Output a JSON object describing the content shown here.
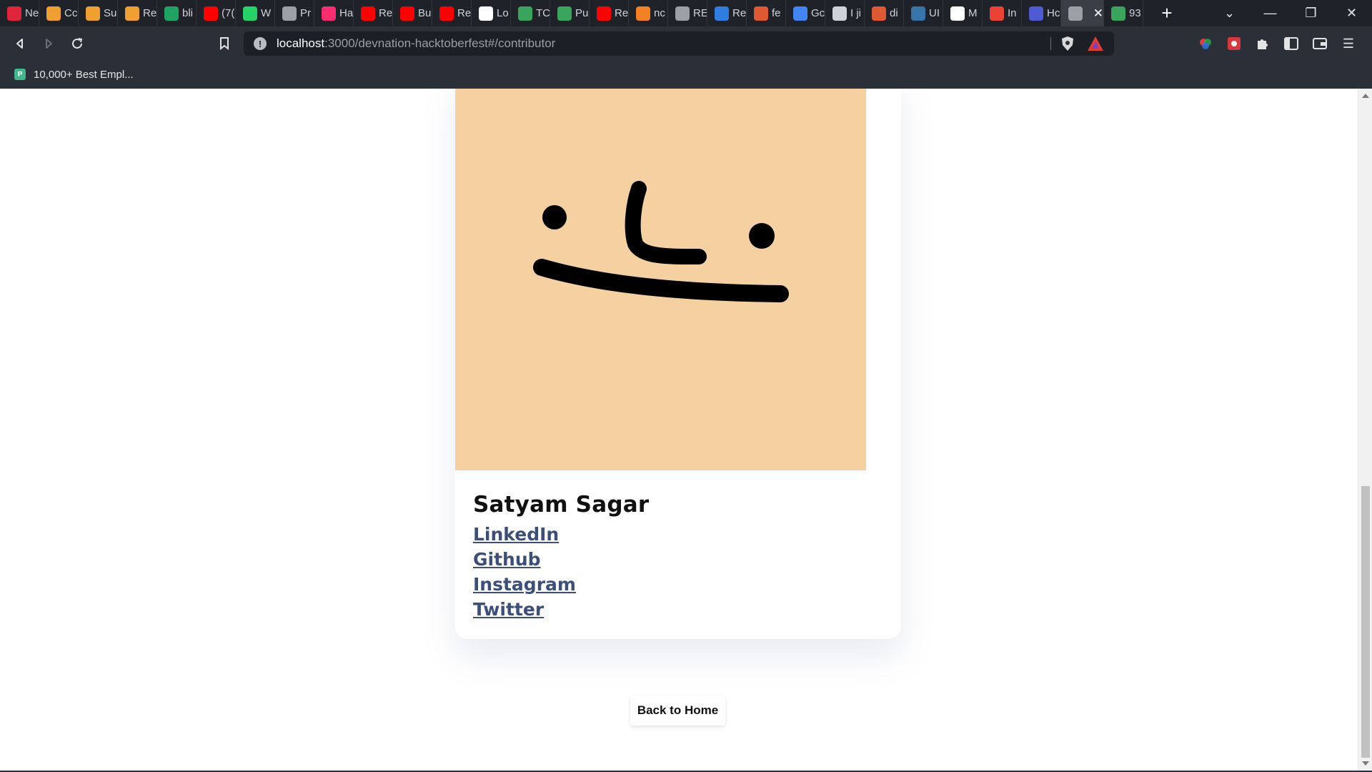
{
  "browser": {
    "tabs": [
      {
        "title": "Ne",
        "icon": "bookmark-red-icon",
        "color": "#e0253a"
      },
      {
        "title": "Cc",
        "icon": "codechef-bolt-icon",
        "color": "#f0a030"
      },
      {
        "title": "Su",
        "icon": "codechef-bolt-icon",
        "color": "#f0a030"
      },
      {
        "title": "Re",
        "icon": "codechef-bolt-icon",
        "color": "#f0a030"
      },
      {
        "title": "bli",
        "icon": "green-plus-icon",
        "color": "#1ea362"
      },
      {
        "title": "(7(",
        "icon": "youtube-icon",
        "color": "#ff0000"
      },
      {
        "title": "W",
        "icon": "whatsapp-icon",
        "color": "#25d366"
      },
      {
        "title": "Pr",
        "icon": "globe-icon",
        "color": "#9aa0a6"
      },
      {
        "title": "Ha",
        "icon": "x-mark-icon",
        "color": "#ff2d6f"
      },
      {
        "title": "Re",
        "icon": "youtube-icon",
        "color": "#ff0000"
      },
      {
        "title": "Bu",
        "icon": "youtube-icon",
        "color": "#ff0000"
      },
      {
        "title": "Re",
        "icon": "youtube-icon",
        "color": "#ff0000"
      },
      {
        "title": "Lo",
        "icon": "square-icon",
        "color": "#ffffff"
      },
      {
        "title": "TC",
        "icon": "tc-icon",
        "color": "#3aa35c"
      },
      {
        "title": "Pu",
        "icon": "tc-icon",
        "color": "#3aa35c"
      },
      {
        "title": "Re",
        "icon": "youtube-icon",
        "color": "#ff0000"
      },
      {
        "title": "nc",
        "icon": "stack-icon",
        "color": "#f48024"
      },
      {
        "title": "RE",
        "icon": "globe-icon",
        "color": "#9aa0a6"
      },
      {
        "title": "Re",
        "icon": "blue-wave-icon",
        "color": "#2f7de1"
      },
      {
        "title": "fe",
        "icon": "duckduckgo-icon",
        "color": "#de5833"
      },
      {
        "title": "Gc",
        "icon": "google-icon",
        "color": "#4285f4"
      },
      {
        "title": "I ji",
        "icon": "letter-a-icon",
        "color": "#cfd2d8"
      },
      {
        "title": "di",
        "icon": "duckduckgo-icon",
        "color": "#de5833"
      },
      {
        "title": "UI",
        "icon": "python-icon",
        "color": "#3776ab"
      },
      {
        "title": "M",
        "icon": "github-icon",
        "color": "#ffffff"
      },
      {
        "title": "In",
        "icon": "gmail-icon",
        "color": "#ea4335"
      },
      {
        "title": "Hc",
        "icon": "u-box-icon",
        "color": "#4f5bd5"
      },
      {
        "title": "",
        "icon": "globe-icon",
        "color": "#9aa0a6",
        "active": true
      },
      {
        "title": "93",
        "icon": "cursor-icon",
        "color": "#3aa35c"
      }
    ],
    "url_host": "localhost",
    "url_rest": ":3000/devnation-hacktoberfest#/contributor",
    "bookmark": "10,000+ Best Empl..."
  },
  "contributor": {
    "name": "Satyam Sagar",
    "links": [
      "LinkedIn",
      "Github",
      "Instagram",
      "Twitter"
    ]
  },
  "actions": {
    "back_label": "Back to Home"
  },
  "colors": {
    "avatar_bg": "#f5d1a2",
    "link": "#3b4f7a"
  }
}
